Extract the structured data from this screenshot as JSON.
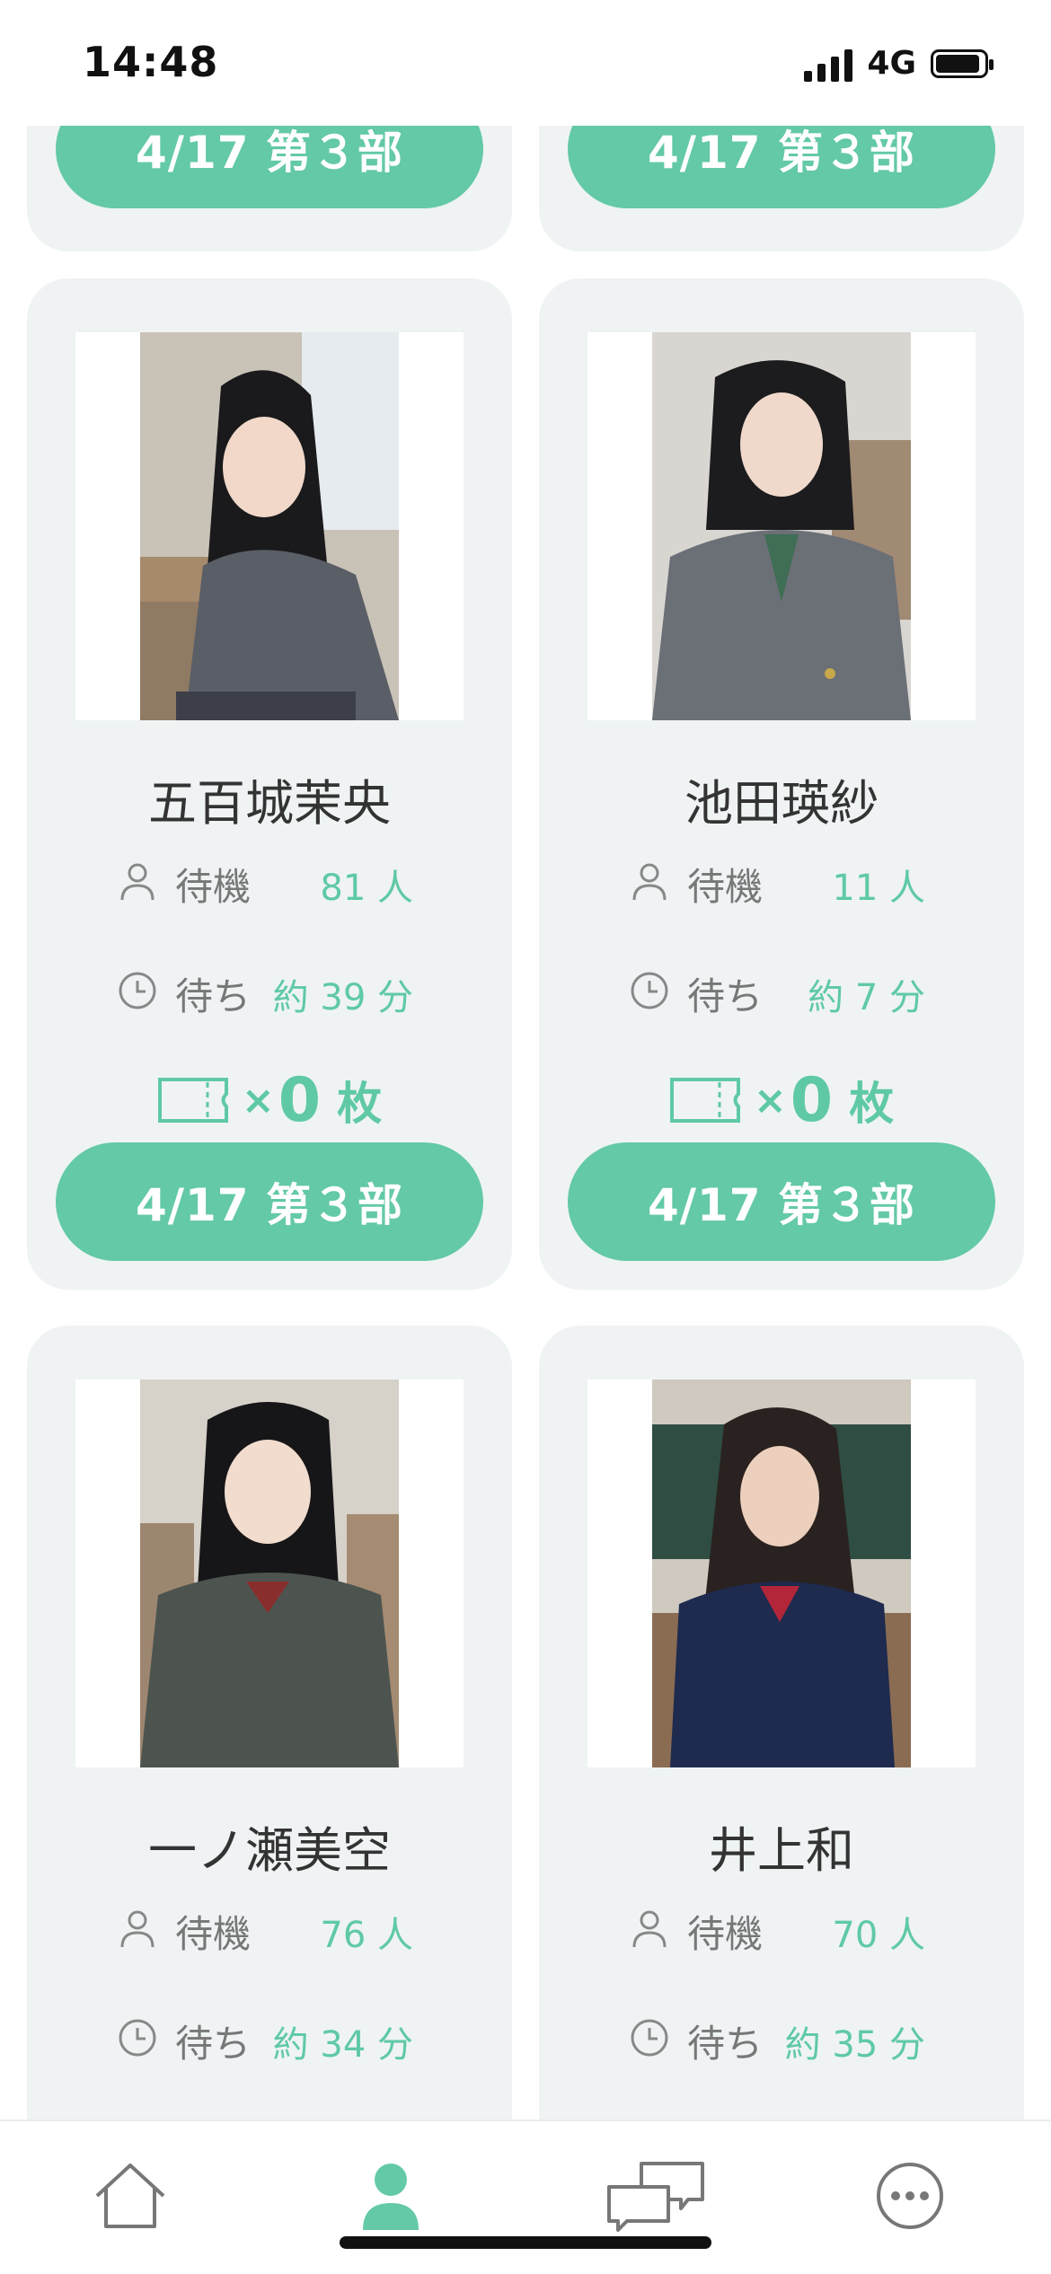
{
  "status_bar": {
    "time": "14:48",
    "network": "4G"
  },
  "top_cards": [
    {
      "session_label": "4/17 第３部"
    },
    {
      "session_label": "4/17 第３部"
    }
  ],
  "members": [
    {
      "name": "五百城茉央",
      "wait_label": "待機",
      "wait_value": "81 人",
      "time_label": "待ち",
      "time_value": "約 39 分",
      "ticket_times": "×",
      "ticket_count": "0",
      "ticket_unit": "枚",
      "session_label": "4/17 第３部"
    },
    {
      "name": "池田瑛紗",
      "wait_label": "待機",
      "wait_value": "11 人",
      "time_label": "待ち",
      "time_value": "約 7 分",
      "ticket_times": "×",
      "ticket_count": "0",
      "ticket_unit": "枚",
      "session_label": "4/17 第３部"
    },
    {
      "name": "一ノ瀬美空",
      "wait_label": "待機",
      "wait_value": "76 人",
      "time_label": "待ち",
      "time_value": "約 34 分"
    },
    {
      "name": "井上和",
      "wait_label": "待機",
      "wait_value": "70 人",
      "time_label": "待ち",
      "time_value": "約 35 分"
    }
  ],
  "tabbar": {
    "items": [
      {
        "icon": "home-icon"
      },
      {
        "icon": "person-icon",
        "active": true
      },
      {
        "icon": "chat-icon"
      },
      {
        "icon": "more-icon"
      }
    ]
  },
  "colors": {
    "accent": "#63c9a6",
    "card_bg": "#eff3f4",
    "text": "#333333",
    "muted": "#777777"
  }
}
